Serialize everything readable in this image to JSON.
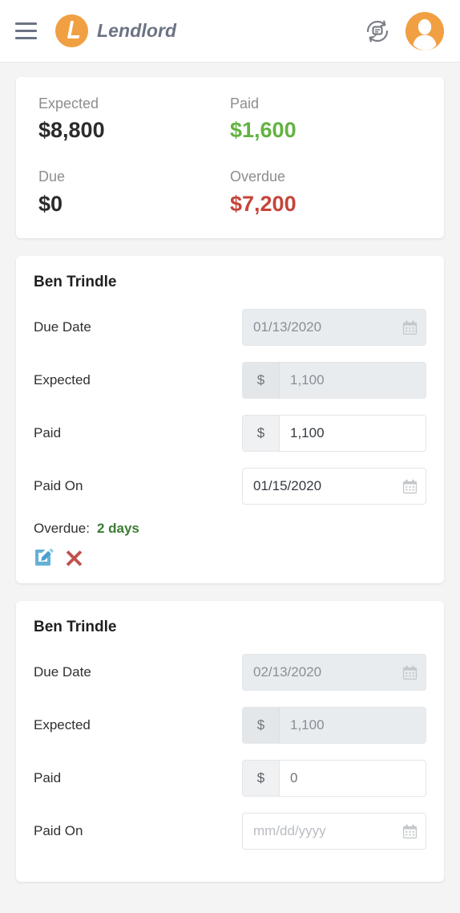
{
  "header": {
    "menu_icon": "hamburger-menu-icon",
    "logo_icon": "lendlord-logo-icon",
    "brand_name": "Lendlord",
    "sync_icon": "sync-message-icon",
    "avatar_icon": "user-avatar-icon"
  },
  "summary": {
    "rows": [
      [
        {
          "label": "Expected",
          "value": "$8,800",
          "tone": ""
        },
        {
          "label": "Paid",
          "value": "$1,600",
          "tone": "green"
        }
      ],
      [
        {
          "label": "Due",
          "value": "$0",
          "tone": ""
        },
        {
          "label": "Overdue",
          "value": "$7,200",
          "tone": "red"
        }
      ]
    ]
  },
  "colors": {
    "brand_orange": "#f0a042",
    "green": "#62b341",
    "red": "#c4453a",
    "overdue_green": "#3d7a34",
    "edit_blue": "#63b2d4",
    "delete_red": "#c0504d"
  },
  "payments": [
    {
      "tenant": "Ben Trindle",
      "due_date": {
        "label": "Due Date",
        "value": "01/13/2020",
        "placeholder": "mm/dd/yyyy",
        "disabled": true
      },
      "expected": {
        "label": "Expected",
        "addon": "$",
        "value": "1,100",
        "placeholder": "0",
        "disabled": true
      },
      "paid": {
        "label": "Paid",
        "addon": "$",
        "value": "1,100",
        "placeholder": "0",
        "disabled": false
      },
      "paid_on": {
        "label": "Paid On",
        "value": "01/15/2020",
        "placeholder": "mm/dd/yyyy",
        "disabled": false
      },
      "overdue": {
        "label": "Overdue:",
        "days": "2 days"
      },
      "actions": {
        "edit": "edit-icon",
        "delete": "delete-icon"
      }
    },
    {
      "tenant": "Ben Trindle",
      "due_date": {
        "label": "Due Date",
        "value": "02/13/2020",
        "placeholder": "mm/dd/yyyy",
        "disabled": true
      },
      "expected": {
        "label": "Expected",
        "addon": "$",
        "value": "1,100",
        "placeholder": "0",
        "disabled": true
      },
      "paid": {
        "label": "Paid",
        "addon": "$",
        "value": "",
        "placeholder": "0",
        "disabled": false
      },
      "paid_on": {
        "label": "Paid On",
        "value": "",
        "placeholder": "mm/dd/yyyy",
        "disabled": false
      }
    }
  ]
}
